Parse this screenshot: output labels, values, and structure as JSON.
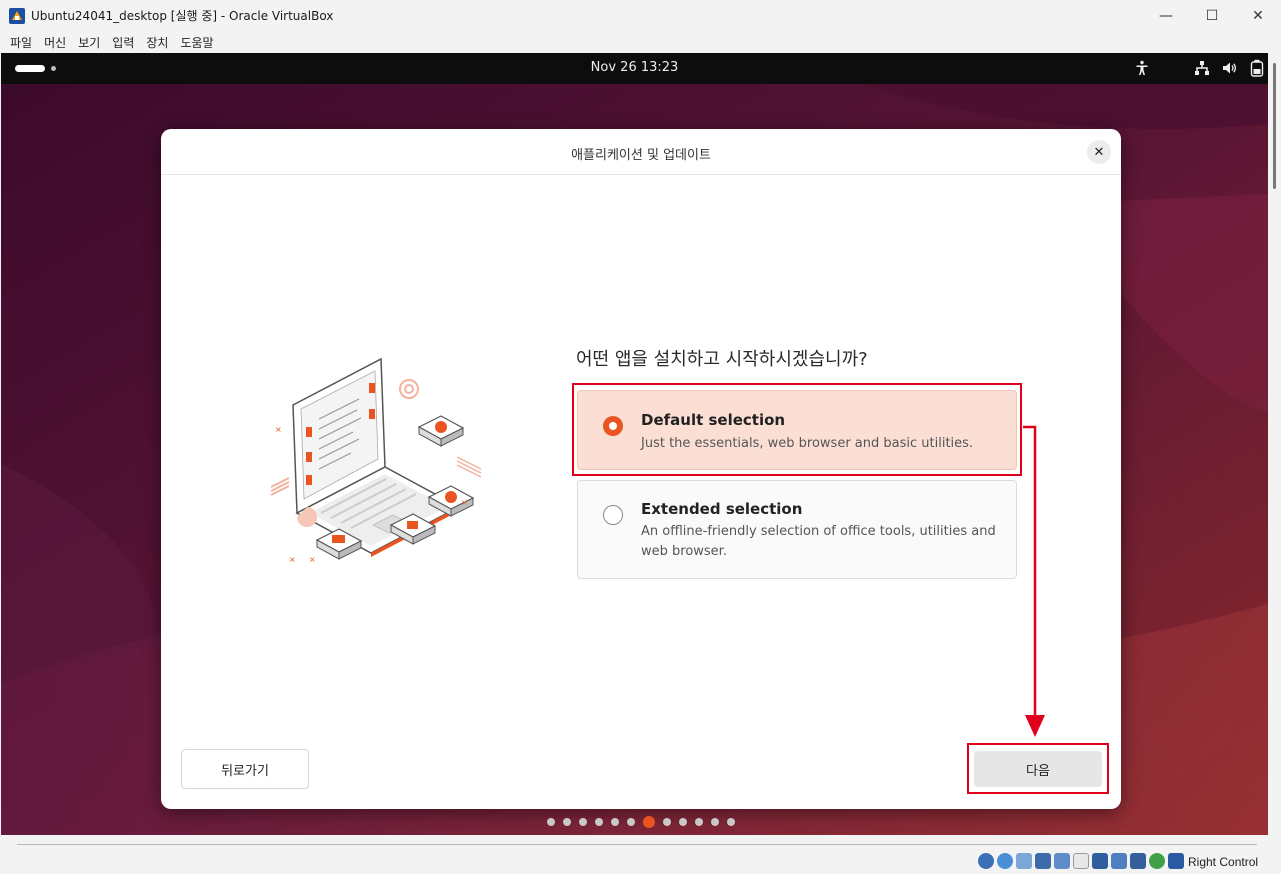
{
  "window": {
    "title": "Ubuntu24041_desktop [실행 중] - Oracle VirtualBox",
    "controls": {
      "minimize": "—",
      "maximize": "☐",
      "close": "✕"
    }
  },
  "menubar": [
    "파일",
    "머신",
    "보기",
    "입력",
    "장치",
    "도움말"
  ],
  "gnome": {
    "clock": "Nov 26  13:23"
  },
  "dialog": {
    "title": "애플리케이션 및 업데이트",
    "question": "어떤 앱을 설치하고 시작하시겠습니까?",
    "options": [
      {
        "title": "Default selection",
        "description": "Just the essentials, web browser and basic utilities.",
        "selected": true
      },
      {
        "title": "Extended selection",
        "description": "An offline-friendly selection of office tools, utilities and web browser.",
        "selected": false
      }
    ],
    "back_label": "뒤로가기",
    "next_label": "다음",
    "pager": {
      "total": 12,
      "current": 7
    }
  },
  "statusbar": {
    "host_key": "Right Control"
  },
  "colors": {
    "accent": "#e95420",
    "annotation": "#e0001b"
  }
}
